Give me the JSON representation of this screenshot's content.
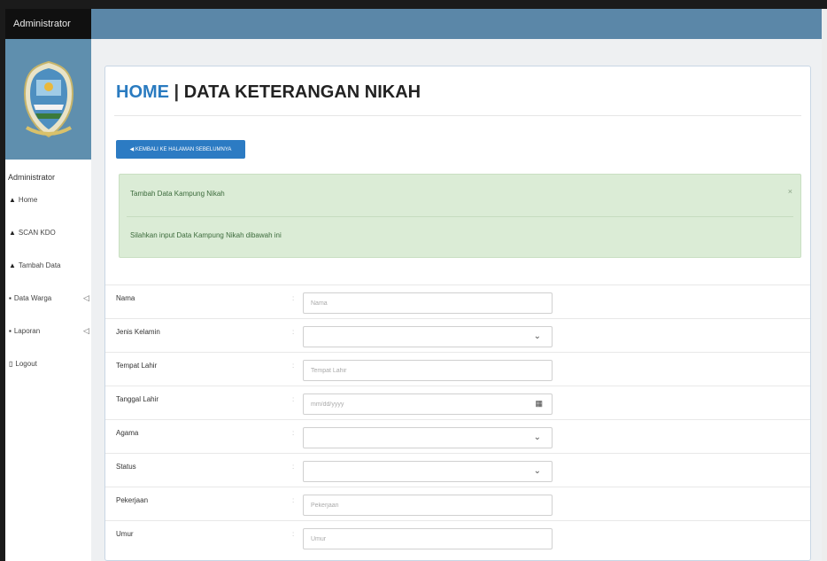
{
  "sidebar": {
    "brand": "Administrator",
    "section_label": "Administrator",
    "items": [
      {
        "label": "Home",
        "icon": "▲",
        "icon_name": "home-icon",
        "arrow": ""
      },
      {
        "label": "SCAN KDO",
        "icon": "▲",
        "icon_name": "scan-icon",
        "arrow": ""
      },
      {
        "label": "Tambah Data",
        "icon": "▲",
        "icon_name": "add-data-icon",
        "arrow": ""
      },
      {
        "label": "Data Warga",
        "icon": "▪",
        "icon_name": "users-icon",
        "arrow": "◁"
      },
      {
        "label": "Laporan",
        "icon": "▪",
        "icon_name": "report-icon",
        "arrow": "◁"
      },
      {
        "label": "Logout",
        "icon": "▯",
        "icon_name": "logout-icon",
        "arrow": ""
      }
    ]
  },
  "page": {
    "title_home": "HOME",
    "title_sep": " | ",
    "title_rest": "DATA KETERANGAN NIKAH",
    "back_button": "◀ KEMBALI KE HALAMAN SEBELUMNYA"
  },
  "alert": {
    "title": "Tambah Data Kampung Nikah",
    "close": "×",
    "text": "Silahkan input Data Kampung Nikah dibawah ini"
  },
  "form": {
    "colon": ":",
    "fields": [
      {
        "label": "Nama",
        "type": "text",
        "placeholder": "Nama"
      },
      {
        "label": "Jenis Kelamin",
        "type": "select",
        "placeholder": ""
      },
      {
        "label": "Tempat Lahir",
        "type": "text",
        "placeholder": "Tempat Lahir"
      },
      {
        "label": "Tanggal Lahir",
        "type": "date",
        "placeholder": "mm/dd/yyyy"
      },
      {
        "label": "Agama",
        "type": "select",
        "placeholder": ""
      },
      {
        "label": "Status",
        "type": "select",
        "placeholder": ""
      },
      {
        "label": "Pekerjaan",
        "type": "text",
        "placeholder": "Pekerjaan"
      },
      {
        "label": "Umur",
        "type": "text",
        "placeholder": "Umur"
      }
    ]
  },
  "colors": {
    "topbar": "#5b87a8",
    "primary": "#2c7bc3",
    "alert_bg": "#dbecd6"
  }
}
